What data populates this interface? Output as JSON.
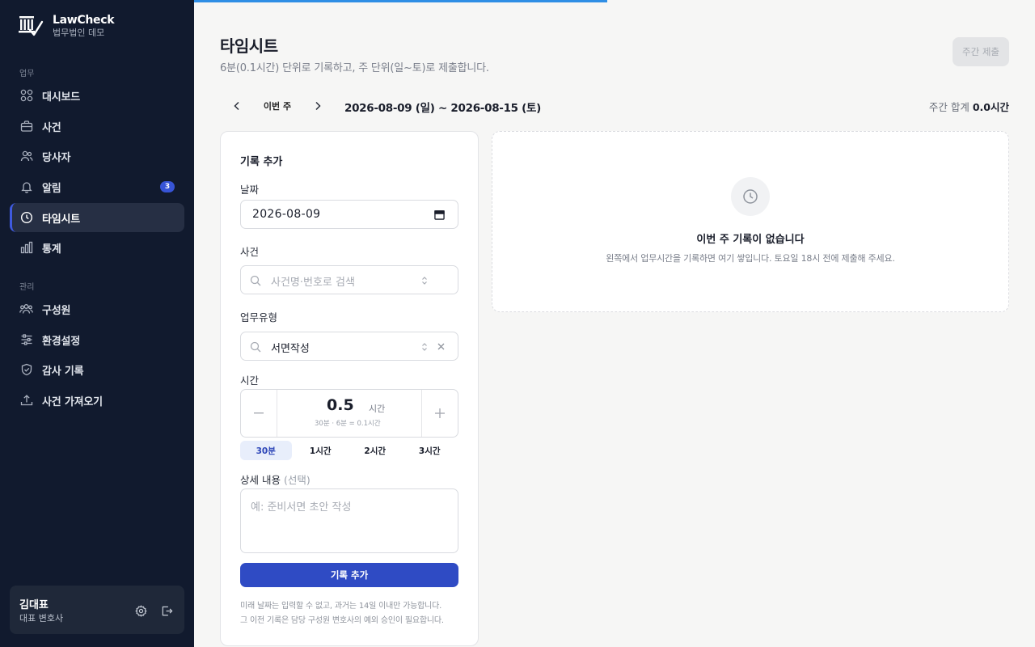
{
  "brand": {
    "name": "LawCheck",
    "subtitle": "법무법인 데모"
  },
  "sidebar": {
    "sections": {
      "work": "업무",
      "admin": "관리"
    },
    "items": [
      {
        "label": "대시보드",
        "icon": "grid-icon"
      },
      {
        "label": "사건",
        "icon": "briefcase-icon"
      },
      {
        "label": "당사자",
        "icon": "users-icon"
      },
      {
        "label": "알림",
        "icon": "bell-icon",
        "badge": "3"
      },
      {
        "label": "타임시트",
        "icon": "clock-icon",
        "active": true
      },
      {
        "label": "통계",
        "icon": "bar-chart-icon"
      },
      {
        "label": "구성원",
        "icon": "team-icon"
      },
      {
        "label": "환경설정",
        "icon": "sliders-icon"
      },
      {
        "label": "감사 기록",
        "icon": "shield-icon"
      },
      {
        "label": "사건 가져오기",
        "icon": "upload-icon"
      }
    ],
    "user": {
      "name": "김대표",
      "role": "대표 변호사"
    }
  },
  "header": {
    "title": "타임시트",
    "subtitle": "6분(0.1시간) 단위로 기록하고, 주 단위(일~토)로 제출합니다.",
    "submit_label": "주간 제출"
  },
  "week": {
    "this_week_label": "이번 주",
    "range": "2026-08-09 (일) ~ 2026-08-15 (토)",
    "total_label": "주간 합계",
    "total_value": "0.0시간"
  },
  "form": {
    "title": "기록 추가",
    "date_label": "날짜",
    "date_value": "2026-08-09",
    "case_label": "사건",
    "case_placeholder": "사건명·번호로 검색",
    "type_label": "업무유형",
    "type_value": "서면작성",
    "time_label": "시간",
    "time_value": "0.5",
    "time_unit": "시간",
    "time_hint": "30분 · 6분 = 0.1시간",
    "presets": [
      "30분",
      "1시간",
      "2시간",
      "3시간"
    ],
    "active_preset": "30분",
    "detail_label": "상세 내용",
    "detail_optional": "(선택)",
    "detail_placeholder": "예: 준비서면 초안 작성",
    "add_label": "기록 추가",
    "note_line1": "미래 날짜는 입력할 수 없고, 과거는 14일 이내만 가능합니다.",
    "note_line2": "그 이전 기록은 담당 구성원 변호사의 예외 승인이 필요합니다."
  },
  "empty": {
    "title": "이번 주 기록이 없습니다",
    "description": "왼쪽에서 업무시간을 기록하면 여기 쌓입니다. 토요일 18시 전에 제출해 주세요."
  },
  "colors": {
    "sidebar_bg": "#111a2e",
    "accent": "#2f4bc4",
    "progress": "#2f8ee5"
  }
}
